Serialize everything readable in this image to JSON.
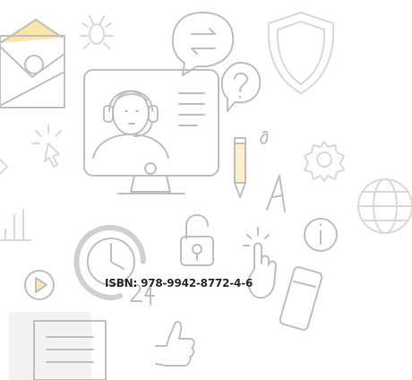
{
  "isbn_text": "ISBN: 978-9942-8772-4-6",
  "colors": {
    "accent_yellow": "#fbe6a8",
    "line_gray": "#bfbfbf",
    "text": "#2b2b2b"
  },
  "icons": [
    "email-envelope-icon",
    "bug-icon",
    "chat-bubble-icon",
    "shield-icon",
    "support-agent-monitor-icon",
    "question-bubble-icon",
    "cursor-click-icon",
    "pencil-icon",
    "gear-icon",
    "globe-icon",
    "bar-chart-icon",
    "clock-24-icon",
    "padlock-icon",
    "touch-hand-icon",
    "info-icon",
    "play-button-icon",
    "smartphone-icon",
    "document-icon",
    "thumbs-up-icon"
  ]
}
